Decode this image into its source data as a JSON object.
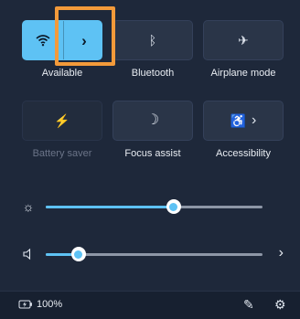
{
  "tiles": {
    "wifi": {
      "label": "Available",
      "icon": "wifi-icon",
      "chevron": "›",
      "state": "on"
    },
    "bluetooth": {
      "label": "Bluetooth",
      "icon": "bluetooth-icon",
      "glyph": "ᛒ"
    },
    "airplane": {
      "label": "Airplane mode",
      "icon": "airplane-icon",
      "glyph": "✈"
    },
    "battery_saver": {
      "label": "Battery saver",
      "icon": "battery-saver-icon",
      "glyph": "⚡",
      "state": "disabled"
    },
    "focus_assist": {
      "label": "Focus assist",
      "icon": "moon-icon",
      "glyph": "☽"
    },
    "accessibility": {
      "label": "Accessibility",
      "icon": "accessibility-icon",
      "glyph": "♿",
      "chevron": "›"
    }
  },
  "sliders": {
    "brightness": {
      "icon": "brightness-icon",
      "glyph": "☼",
      "level": 0.59
    },
    "volume": {
      "icon": "speaker-icon",
      "glyph": "🔈",
      "level": 0.15,
      "chevron": "›"
    }
  },
  "footer": {
    "battery_text": "100%",
    "battery_icon": "battery-charging-icon",
    "edit_icon": "pencil-icon",
    "settings_icon": "gear-icon"
  },
  "colors": {
    "accent": "#5ec2f4",
    "highlight": "#f39a3a",
    "panel": "#1e283a"
  }
}
